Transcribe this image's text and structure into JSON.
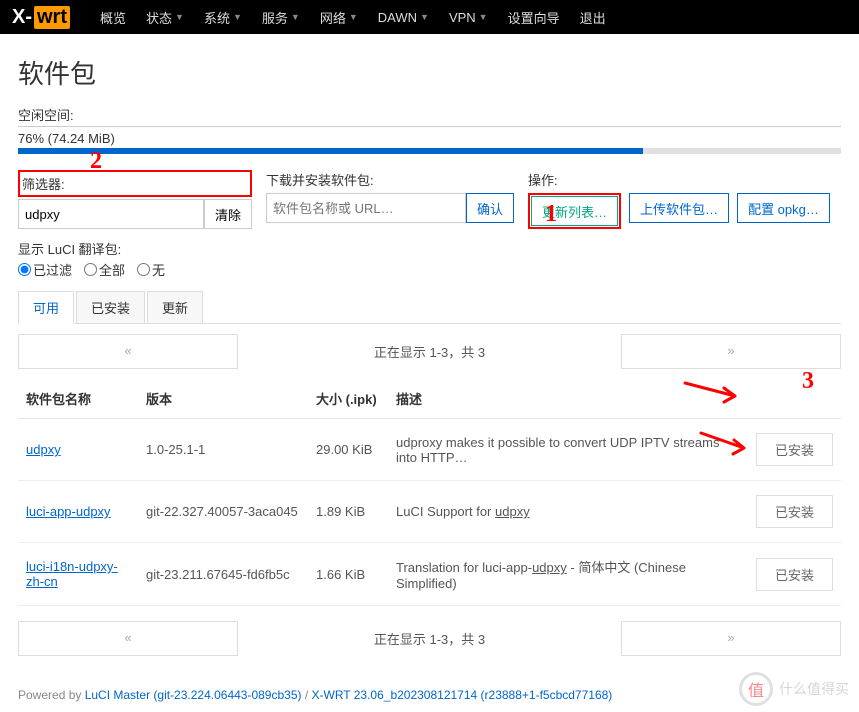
{
  "logo": {
    "x": "X-",
    "wrt": "wrt"
  },
  "nav": [
    "概览",
    "状态",
    "系统",
    "服务",
    "网络",
    "DAWN",
    "VPN",
    "设置向导",
    "退出"
  ],
  "nav_has_caret": [
    false,
    true,
    true,
    true,
    true,
    true,
    true,
    false,
    false
  ],
  "page_title": "软件包",
  "free_space": {
    "label": "空闲空间:",
    "value": "76% (74.24 MiB)",
    "percent": 76
  },
  "filter": {
    "label": "筛选器:",
    "value": "udpxy",
    "clear": "清除"
  },
  "download": {
    "label": "下载并安装软件包:",
    "placeholder": "软件包名称或 URL…",
    "confirm": "确认"
  },
  "actions": {
    "label": "操作:",
    "update": "更新列表…",
    "upload": "上传软件包…",
    "config": "配置 opkg…"
  },
  "luci_trans": {
    "label": "显示 LuCI 翻译包:",
    "filtered": "已过滤",
    "all": "全部",
    "none": "无"
  },
  "tabs": {
    "available": "可用",
    "installed": "已安装",
    "updates": "更新"
  },
  "pager": {
    "prev": "«",
    "info": "正在显示 1-3，共 3",
    "next": "»"
  },
  "table": {
    "headers": {
      "name": "软件包名称",
      "version": "版本",
      "size": "大小 (.ipk)",
      "desc": "描述"
    },
    "rows": [
      {
        "name": "udpxy",
        "version": "1.0-25.1-1",
        "size": "29.00 KiB",
        "desc_pre": "udproxy makes it possible to convert UDP IPTV streams into HTTP…",
        "desc_link": "",
        "desc_post": "",
        "action": "已安装"
      },
      {
        "name": "luci-app-udpxy",
        "version": "git-22.327.40057-3aca045",
        "size": "1.89 KiB",
        "desc_pre": "LuCI Support for ",
        "desc_link": "udpxy",
        "desc_post": "",
        "action": "已安装"
      },
      {
        "name": "luci-i18n-udpxy-zh-cn",
        "version": "git-23.211.67645-fd6fb5c",
        "size": "1.66 KiB",
        "desc_pre": "Translation for luci-app-",
        "desc_link": "udpxy",
        "desc_post": " - 简体中文 (Chinese Simplified)",
        "action": "已安装"
      }
    ]
  },
  "footer": {
    "powered": "Powered by ",
    "luci": "LuCI Master (git-23.224.06443-089cb35)",
    "sep": " / ",
    "xwrt": "X-WRT 23.06_b202308121714 (r23888+1-f5cbcd77168)"
  },
  "annotations": {
    "n1": "1",
    "n2": "2",
    "n3": "3"
  },
  "watermark": {
    "badge": "值",
    "text": "什么值得买"
  }
}
